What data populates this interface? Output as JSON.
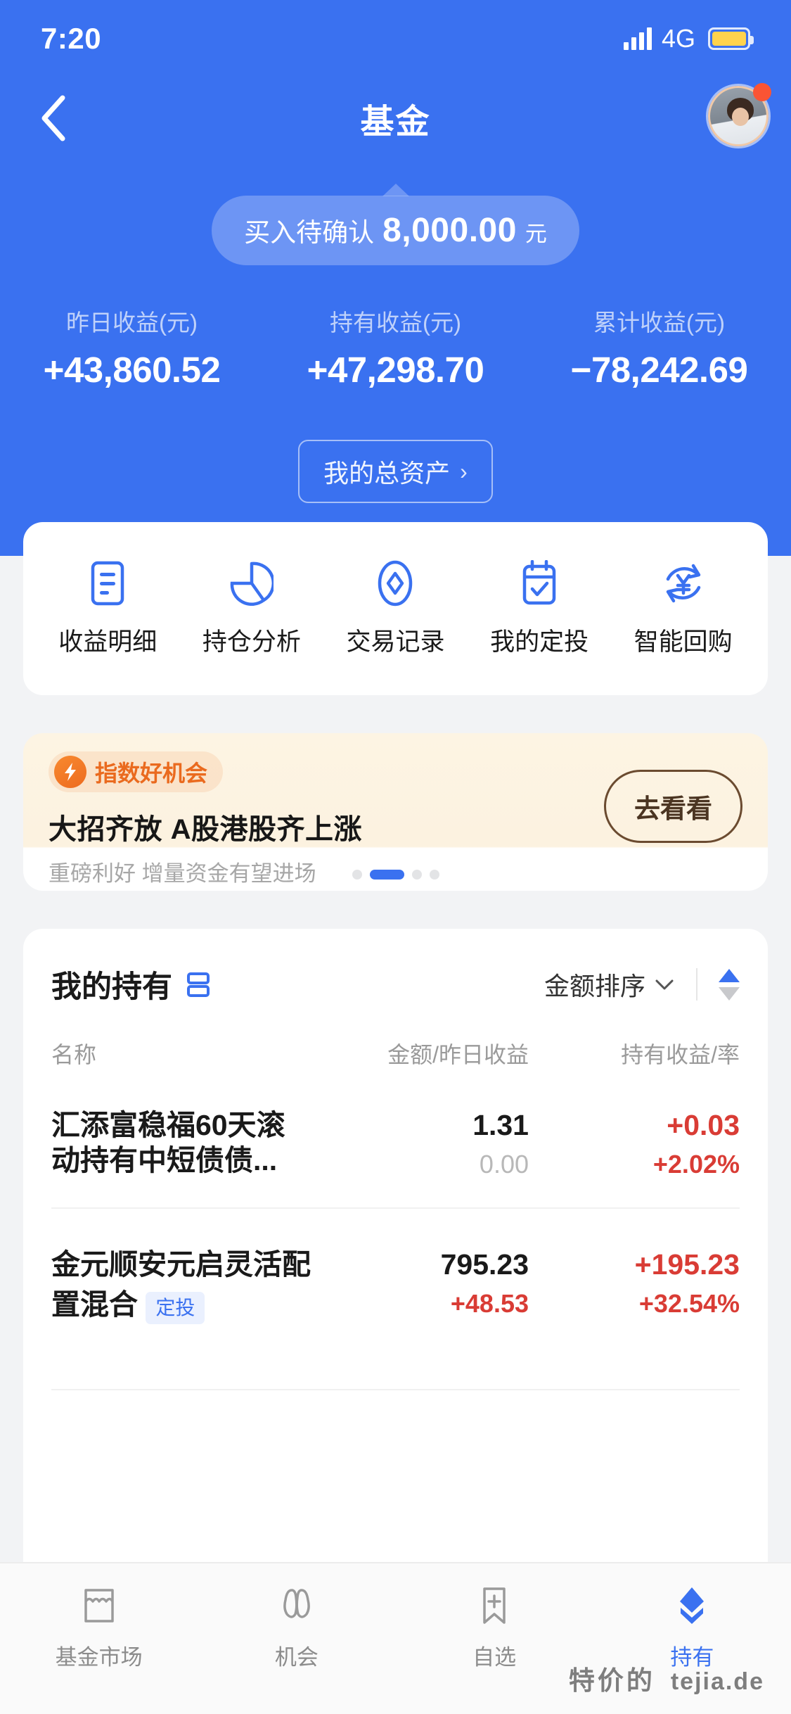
{
  "status_bar": {
    "time": "7:20",
    "network": "4G",
    "signal_icon": "signal-bars-icon",
    "battery_icon": "battery-icon"
  },
  "nav": {
    "back_icon": "chevron-left-icon",
    "title": "基金",
    "avatar_icon": "user-avatar",
    "badge_icon": "notification-dot"
  },
  "pending": {
    "label": "买入待确认",
    "amount": "8,000.00",
    "unit": "元"
  },
  "stats": [
    {
      "label": "昨日收益(元)",
      "value": "+43,860.52"
    },
    {
      "label": "持有收益(元)",
      "value": "+47,298.70"
    },
    {
      "label": "累计收益(元)",
      "value": "−78,242.69"
    }
  ],
  "asset_button": {
    "label": "我的总资产",
    "chevron": "›"
  },
  "quick_actions": [
    {
      "label": "收益明细",
      "icon": "document-list-icon"
    },
    {
      "label": "持仓分析",
      "icon": "pie-chart-icon"
    },
    {
      "label": "交易记录",
      "icon": "diamond-icon"
    },
    {
      "label": "我的定投",
      "icon": "calendar-check-icon"
    },
    {
      "label": "智能回购",
      "icon": "yuan-refresh-icon"
    }
  ],
  "banner": {
    "tag": "指数好机会",
    "tag_icon": "lightning-circle-icon",
    "title": "大招齐放 A股港股齐上涨",
    "subtitle": "重磅利好 增量资金有望进场",
    "button": "去看看",
    "dots_total": 4,
    "dots_active_index": 1
  },
  "holdings": {
    "title": "我的持有",
    "title_icon": "list-view-icon",
    "sort_label": "金额排序",
    "sort_chevron": "⌄",
    "sort_arrows_icon": "sort-arrows-icon",
    "columns": [
      "名称",
      "金额/昨日收益",
      "持有收益/率"
    ],
    "rows": [
      {
        "name": "汇添富稳福60天滚动持有中短债债...",
        "amount": "1.31",
        "yesterday": "0.00",
        "yesterday_positive": false,
        "profit": "+0.03",
        "rate": "+2.02%",
        "badge": ""
      },
      {
        "name": "金元顺安元启灵活配置混合",
        "amount": "795.23",
        "yesterday": "+48.53",
        "yesterday_positive": true,
        "profit": "+195.23",
        "rate": "+32.54%",
        "badge": "定投"
      }
    ]
  },
  "bottom_nav": [
    {
      "label": "基金市场",
      "icon": "store-icon",
      "active": false
    },
    {
      "label": "机会",
      "icon": "binoculars-icon",
      "active": false
    },
    {
      "label": "自选",
      "icon": "bookmark-plus-icon",
      "active": false
    },
    {
      "label": "持有",
      "icon": "layers-diamond-icon",
      "active": true
    }
  ],
  "watermark": {
    "cn": "特价的",
    "en": "tejia.de"
  },
  "colors": {
    "brand_blue": "#3a71f0",
    "up_red": "#d93c35",
    "muted_gray": "#b8b8b8",
    "banner_orange": "#ea6a1e",
    "battery_yellow": "#ffd34d"
  }
}
